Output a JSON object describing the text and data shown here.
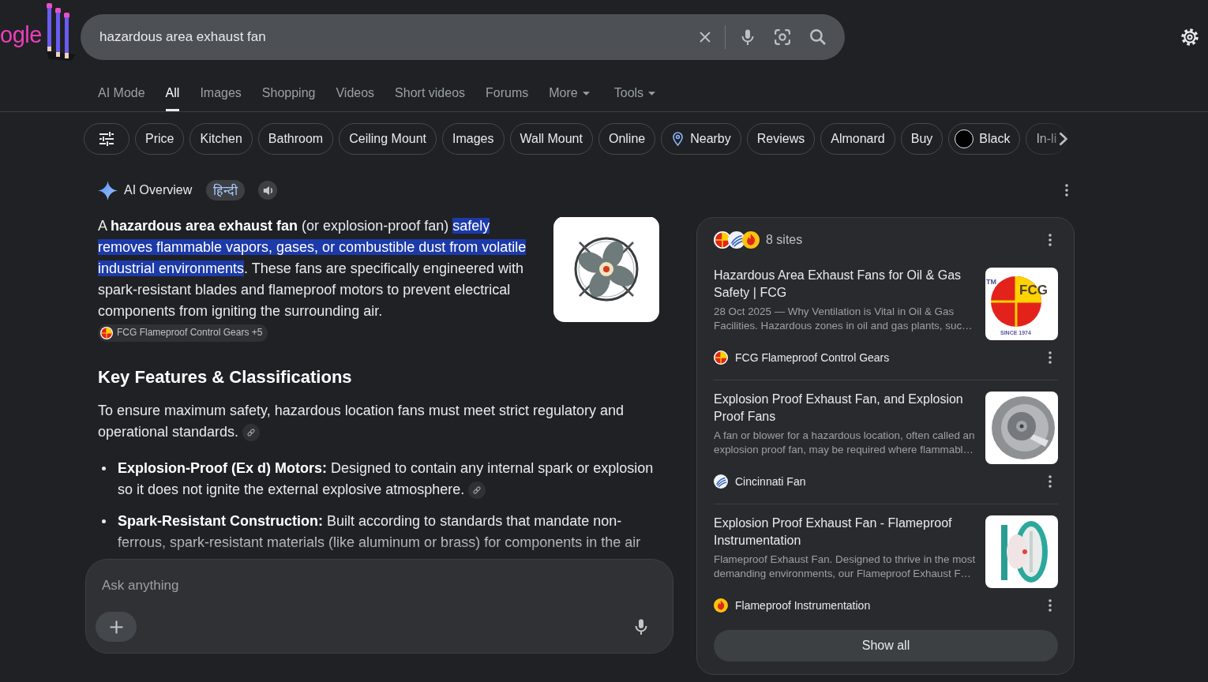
{
  "logo": {
    "text": "ogle"
  },
  "search": {
    "value": "hazardous area exhaust fan"
  },
  "tabs": [
    {
      "label": "AI Mode",
      "selected": false,
      "dropdown": false
    },
    {
      "label": "All",
      "selected": true,
      "dropdown": false
    },
    {
      "label": "Images",
      "selected": false,
      "dropdown": false
    },
    {
      "label": "Shopping",
      "selected": false,
      "dropdown": false
    },
    {
      "label": "Videos",
      "selected": false,
      "dropdown": false
    },
    {
      "label": "Short videos",
      "selected": false,
      "dropdown": false
    },
    {
      "label": "Forums",
      "selected": false,
      "dropdown": false
    },
    {
      "label": "More",
      "selected": false,
      "dropdown": true
    }
  ],
  "tools": {
    "label": "Tools"
  },
  "chips": [
    {
      "kind": "filter"
    },
    {
      "kind": "text",
      "label": "Price"
    },
    {
      "kind": "text",
      "label": "Kitchen"
    },
    {
      "kind": "text",
      "label": "Bathroom"
    },
    {
      "kind": "text",
      "label": "Ceiling Mount"
    },
    {
      "kind": "text",
      "label": "Images"
    },
    {
      "kind": "text",
      "label": "Wall Mount"
    },
    {
      "kind": "text",
      "label": "Online"
    },
    {
      "kind": "location",
      "label": "Nearby"
    },
    {
      "kind": "text",
      "label": "Reviews"
    },
    {
      "kind": "text",
      "label": "Almonard"
    },
    {
      "kind": "text",
      "label": "Buy"
    },
    {
      "kind": "color",
      "label": "Black",
      "color": "#000000"
    },
    {
      "kind": "text",
      "label": "In-li"
    }
  ],
  "ai_overview": {
    "title": "AI Overview",
    "language": "हिन्दी",
    "intro": {
      "before": "A **hazardous area exhaust fan** (or explosion-proof fan) ",
      "highlight": "safely removes flammable vapors, gases, or combustible dust from volatile industrial environments",
      "after": ". These fans are specifically engineered with spark-resistant blades and flameproof motors to prevent electrical components from igniting the surrounding air.",
      "citation": {
        "label": "FCG Flameproof Control Gears +5",
        "kind": "quartered"
      }
    },
    "heading": "Key Features & Classifications",
    "paragraph": {
      "text": "To ensure maximum safety, hazardous location fans must meet strict regulatory and operational standards.",
      "link": true
    },
    "bullets": [
      {
        "text": "**Explosion-Proof (Ex d) Motors:** Designed to contain any internal spark or explosion so it does not ignite the external explosive atmosphere.",
        "link": true
      },
      {
        "text": "**Spark-Resistant Construction:** Built according to standards that mandate non-ferrous, spark-resistant materials (like aluminum or brass) for components in the air",
        "link": false
      }
    ]
  },
  "sources": {
    "count": "8 sites",
    "results": [
      {
        "title": "Hazardous Area Exhaust Fans for Oil & Gas Safety | FCG",
        "snippet": "28 Oct 2025 — Why Ventilation is Vital in Oil & Gas Facilities. Hazardous zones in oil and gas plants, suc…",
        "source": {
          "name": "FCG Flameproof Control Gears",
          "kind": "quartered"
        },
        "thumbnail": {
          "kind": "logo",
          "mark": "TM",
          "name": "FCG",
          "tagline": "SINCE 1974"
        }
      },
      {
        "title": "Explosion Proof Exhaust Fan, and Explosion Proof Fans",
        "snippet": "A fan or blower for a hazardous location, often called an explosion proof fan, may be required where flammabl…",
        "source": {
          "name": "Cincinnati Fan",
          "kind": "swirl"
        },
        "thumbnail": {
          "kind": "blower"
        }
      },
      {
        "title": "Explosion Proof Exhaust Fan - Flameproof Instrumentation",
        "snippet": "Flameproof Exhaust Fan. Designed to thrive in the most demanding environments, our Flameproof Exhaust F…",
        "source": {
          "name": "Flameproof Instrumentation",
          "kind": "flame"
        },
        "thumbnail": {
          "kind": "axial-fan"
        }
      }
    ],
    "button": "Show all"
  },
  "ask": {
    "placeholder": "Ask anything"
  }
}
